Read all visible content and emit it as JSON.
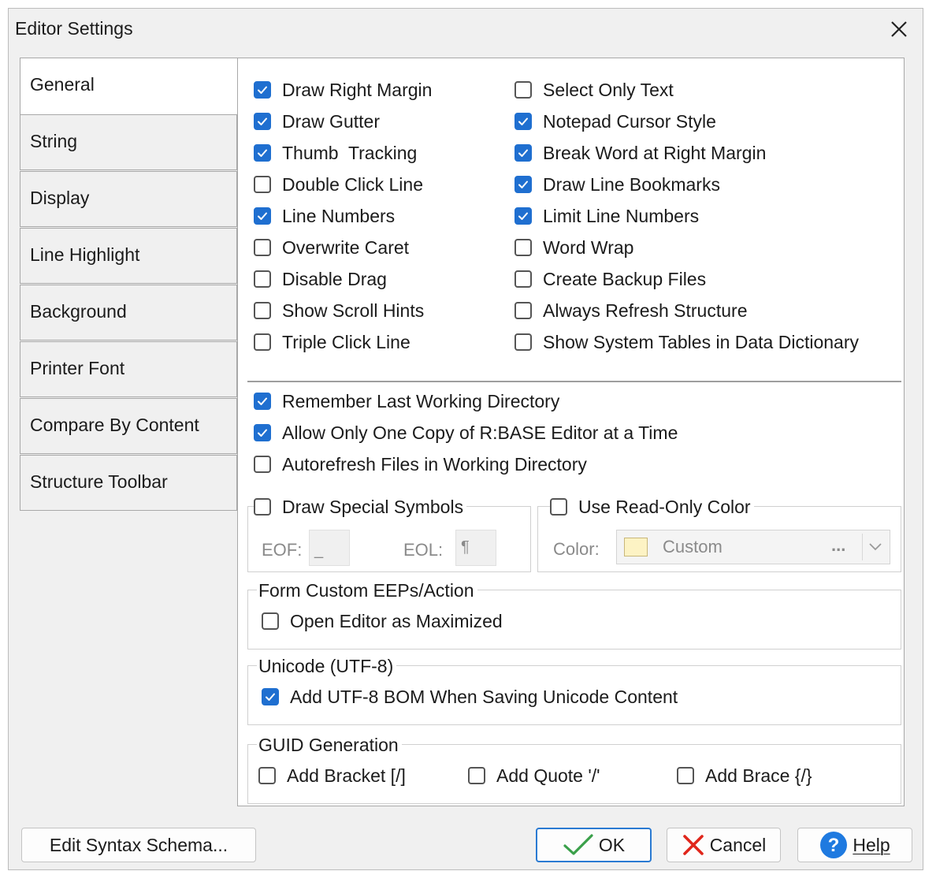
{
  "window": {
    "title": "Editor Settings"
  },
  "tabs": [
    "General",
    "String",
    "Display",
    "Line Highlight",
    "Background",
    "Printer Font",
    "Compare By Content",
    "Structure Toolbar"
  ],
  "options_left": [
    {
      "label": "Draw Right Margin",
      "checked": true
    },
    {
      "label": "Draw Gutter",
      "checked": true
    },
    {
      "label": "Thumb  Tracking",
      "checked": true
    },
    {
      "label": "Double Click Line",
      "checked": false
    },
    {
      "label": "Line Numbers",
      "checked": true
    },
    {
      "label": "Overwrite Caret",
      "checked": false
    },
    {
      "label": "Disable Drag",
      "checked": false
    },
    {
      "label": "Show Scroll Hints",
      "checked": false
    },
    {
      "label": "Triple Click Line",
      "checked": false
    }
  ],
  "options_right": [
    {
      "label": "Select Only Text",
      "checked": false
    },
    {
      "label": "Notepad Cursor Style",
      "checked": true
    },
    {
      "label": "Break Word at Right Margin",
      "checked": true
    },
    {
      "label": "Draw Line Bookmarks",
      "checked": true
    },
    {
      "label": "Limit Line Numbers",
      "checked": true
    },
    {
      "label": "Word Wrap",
      "checked": false
    },
    {
      "label": "Create Backup Files",
      "checked": false
    },
    {
      "label": "Always Refresh Structure",
      "checked": false
    },
    {
      "label": "Show System Tables in Data Dictionary",
      "checked": false
    }
  ],
  "options_dir": [
    {
      "label": "Remember Last Working Directory",
      "checked": true
    },
    {
      "label": "Allow Only One Copy of R:BASE Editor at a Time",
      "checked": true
    },
    {
      "label": "Autorefresh Files in Working Directory",
      "checked": false
    }
  ],
  "special_symbols": {
    "label": "Draw Special Symbols",
    "checked": false,
    "eof_label": "EOF:",
    "eof_value": "_",
    "eol_label": "EOL:",
    "eol_value": "¶"
  },
  "readonly_color": {
    "label": "Use Read-Only Color",
    "checked": false,
    "color_label": "Color:",
    "value": "Custom",
    "swatch": "#fdf3c4",
    "ellipsis": "..."
  },
  "form_custom": {
    "title": "Form Custom EEPs/Action",
    "option": {
      "label": "Open Editor as Maximized",
      "checked": false
    }
  },
  "unicode": {
    "title": "Unicode (UTF-8)",
    "option": {
      "label": "Add UTF-8 BOM When Saving Unicode Content",
      "checked": true
    }
  },
  "guid": {
    "title": "GUID Generation",
    "options": [
      {
        "label": "Add Bracket [/]",
        "checked": false
      },
      {
        "label": "Add Quote '/'",
        "checked": false
      },
      {
        "label": "Add Brace {/}",
        "checked": false
      }
    ]
  },
  "buttons": {
    "edit_schema": "Edit Syntax Schema...",
    "ok": "OK",
    "cancel": "Cancel",
    "help": "Help"
  },
  "colors": {
    "accent": "#1f6fd0",
    "ok_check": "#3aa04a",
    "cancel_x": "#e0261b",
    "help_icon": "#1f7ae0"
  }
}
